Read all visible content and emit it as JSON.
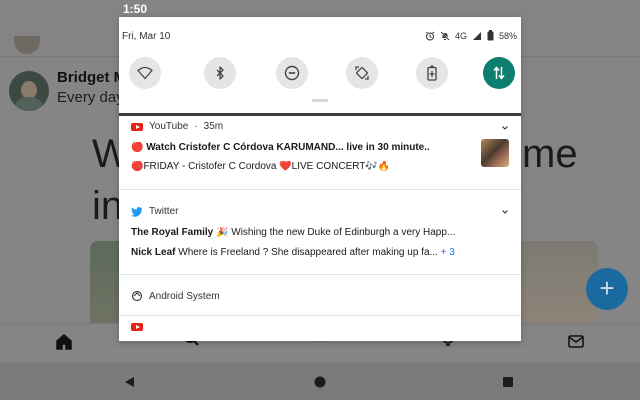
{
  "status_bar": {
    "time": "1:50"
  },
  "background_app": {
    "author_name": "Bridget M",
    "author_subtitle": "Every day",
    "big_text_line1": "W",
    "big_text_right": "me",
    "big_text_line2": "in",
    "fab_label": "+"
  },
  "quick_settings": {
    "date": "Fri, Mar 10",
    "network_label": "4G",
    "battery_percent": "58%",
    "tiles": [
      {
        "name": "wifi",
        "active": false
      },
      {
        "name": "bluetooth",
        "active": false
      },
      {
        "name": "do-not-disturb",
        "active": false
      },
      {
        "name": "auto-rotate",
        "active": false
      },
      {
        "name": "battery-saver",
        "active": false
      },
      {
        "name": "mobile-data",
        "active": true
      }
    ]
  },
  "notifications": {
    "youtube": {
      "app": "YouTube",
      "time": "35m",
      "line1": "🔴 Watch Cristofer C Córdova KARUMAND... live in 30 minute..",
      "line2": "🔴FRIDAY - Cristofer C Cordova ❤️LIVE CONCERT🎶🔥"
    },
    "twitter": {
      "app": "Twitter",
      "line1_name": "The Royal Family",
      "line1_text": "🎉 Wishing the new Duke of Edinburgh a very Happ...",
      "line2_name": "Nick Leaf",
      "line2_text": "Where is Freeland ? She disappeared after making up fa...",
      "more_count": "+ 3"
    },
    "android_system": {
      "app": "Android System"
    }
  },
  "colors": {
    "accent": "#0e7e6f",
    "youtube_red": "#e62117",
    "twitter_blue": "#1d9bf0",
    "link_blue": "#1a73e8"
  }
}
